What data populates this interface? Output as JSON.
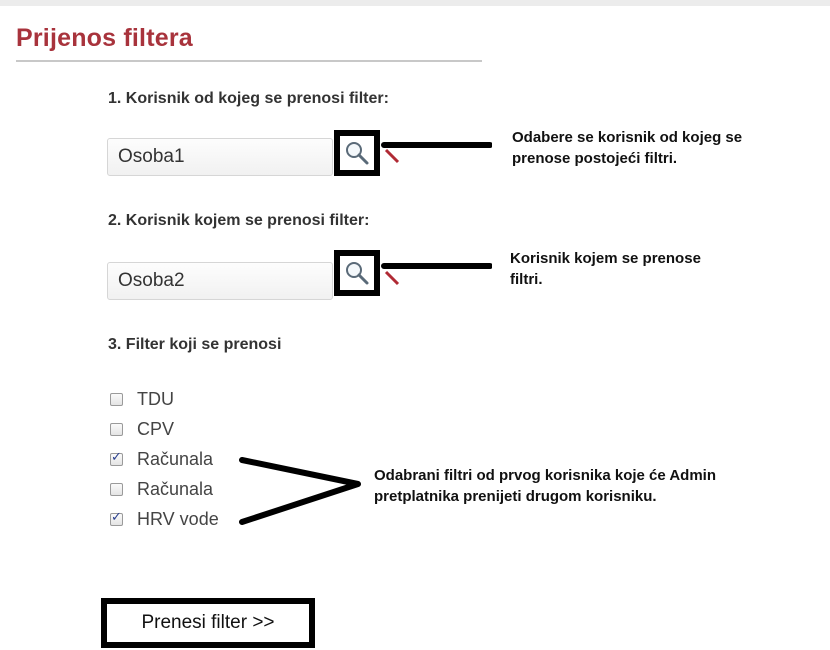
{
  "page": {
    "title": "Prijenos filtera"
  },
  "step1": {
    "label": "1. Korisnik od kojeg se prenosi filter:",
    "value": "Osoba1",
    "search_icon": "search-icon",
    "clear_icon": "clear-icon"
  },
  "step2": {
    "label": "2. Korisnik kojem se prenosi filter:",
    "value": "Osoba2",
    "search_icon": "search-icon",
    "clear_icon": "clear-icon"
  },
  "step3": {
    "label": "3. Filter koji se prenosi",
    "filters": [
      {
        "label": "TDU",
        "checked": false
      },
      {
        "label": "CPV",
        "checked": false
      },
      {
        "label": "Računala",
        "checked": true
      },
      {
        "label": "Računala",
        "checked": false
      },
      {
        "label": "HRV vode",
        "checked": true
      }
    ]
  },
  "annotations": {
    "step1_lines": [
      "Odabere se korisnik od kojeg se",
      "prenose postojeći filtri."
    ],
    "step2_lines": [
      "Korisnik kojem se prenose",
      "filtri."
    ],
    "step3_lines": [
      "Odabrani filtri od prvog korisnika koje će Admin",
      "pretplatnika prenijeti drugom korisniku."
    ]
  },
  "actions": {
    "submit_label": "Prenesi filter >>"
  },
  "colors": {
    "title": "#a8333c",
    "annotation": "#000000"
  }
}
